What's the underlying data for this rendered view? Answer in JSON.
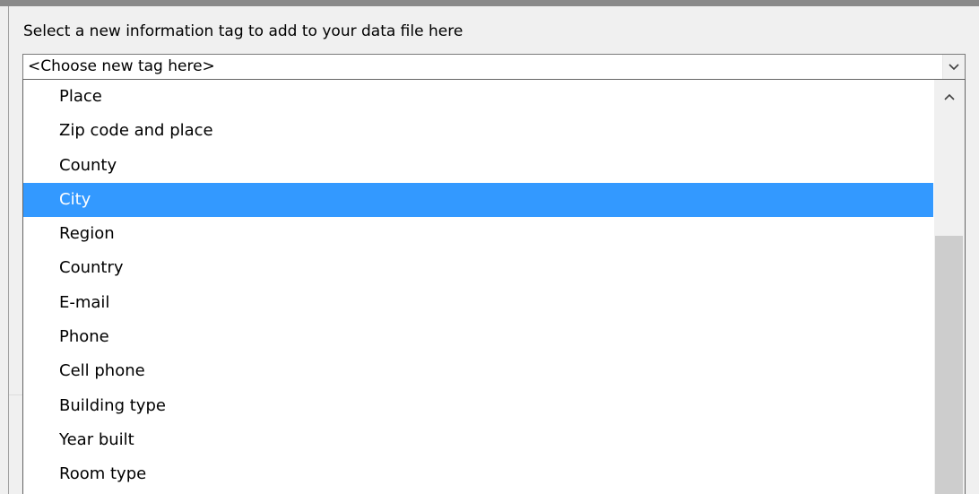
{
  "dialog": {
    "prompt": "Select a new information tag to add to your data file here"
  },
  "tag_select": {
    "value": "<Choose new tag here>",
    "expanded": true
  },
  "dropdown": {
    "selected_index": 3,
    "options": [
      "Place",
      "Zip code and place",
      "County",
      "City",
      "Region",
      "Country",
      "E-mail",
      "Phone",
      "Cell phone",
      "Building type",
      "Year built",
      "Room type"
    ],
    "scroll": {
      "position_fraction": 0.32
    }
  },
  "colors": {
    "selection": "#3399ff",
    "frame": "#8a8a8a",
    "dialog_background": "#f0f0f0",
    "scroll_thumb": "#cdcdcd"
  },
  "icons": {
    "dropdown_arrow": "chevron-down-icon",
    "scroll_up": "chevron-up-icon"
  }
}
